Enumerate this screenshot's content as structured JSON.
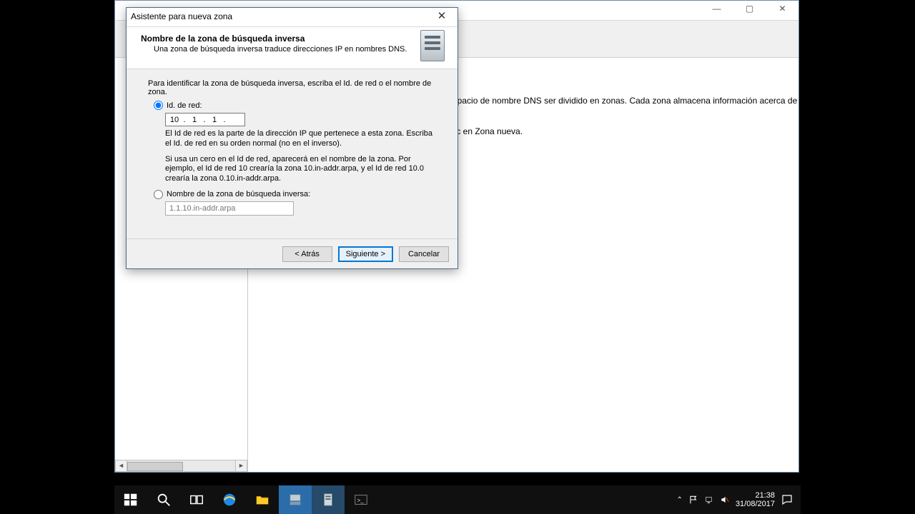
{
  "bg_window": {
    "text_line1": "espacio de nombre DNS ser dividido en zonas. Cada zona almacena información acerca de",
    "text_line2": "clic en Zona nueva."
  },
  "wizard": {
    "title": "Asistente para nueva zona",
    "header_title": "Nombre de la zona de búsqueda inversa",
    "header_sub": "Una zona de búsqueda inversa traduce direcciones IP en nombres DNS.",
    "intro": "Para identificar la zona de búsqueda inversa, escriba el Id. de red o el nombre de zona.",
    "radio_netid": "Id. de red:",
    "ip": {
      "o1": "10",
      "o2": "1",
      "o3": "1",
      "o4": ""
    },
    "hint1": "El Id de red es la parte de la dirección IP que pertenece a esta zona. Escriba el Id. de red en su orden normal (no en el inverso).",
    "hint2": "Si usa un cero en el Id de red, aparecerá en el nombre de la zona.  Por ejemplo, el Id de red 10 crearía la zona 10.in-addr.arpa, y el Id de red 10.0 crearía la zona 0.10.in-addr.arpa.",
    "radio_zonename": "Nombre de la zona de búsqueda inversa:",
    "zone_value": "1.1.10.in-addr.arpa",
    "buttons": {
      "back": "< Atrás",
      "next": "Siguiente >",
      "cancel": "Cancelar"
    }
  },
  "taskbar": {
    "time": "21:38",
    "date": "31/08/2017"
  }
}
